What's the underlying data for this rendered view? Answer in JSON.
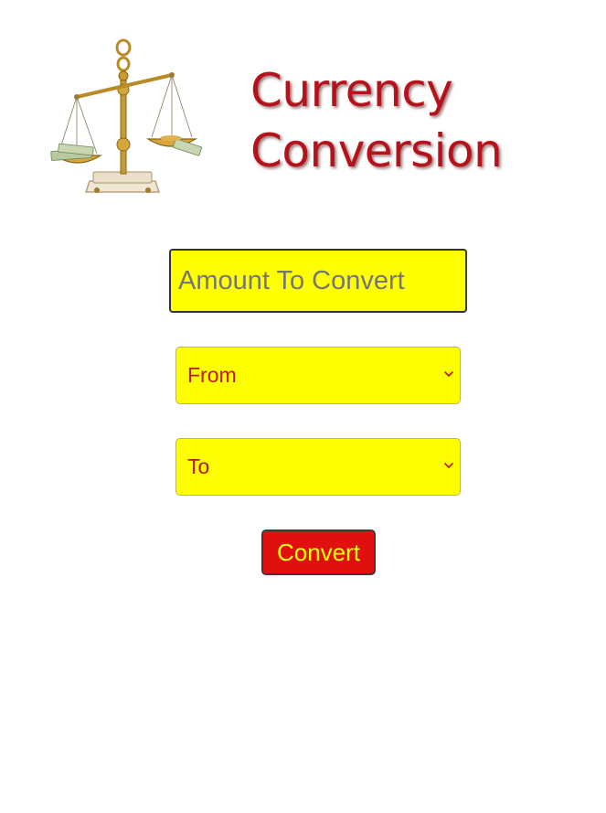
{
  "header": {
    "title_line1": "Currency",
    "title_line2": "Conversion",
    "logo_icon": "balance-scale-icon"
  },
  "form": {
    "amount_placeholder": "Amount To Convert",
    "amount_value": "",
    "from_label": "From",
    "to_label": "To",
    "convert_label": "Convert"
  },
  "colors": {
    "field_background": "#ffff00",
    "select_text": "#c01818",
    "button_background": "#e01010",
    "button_text": "#ffff00",
    "title_text": "#b5121b"
  }
}
